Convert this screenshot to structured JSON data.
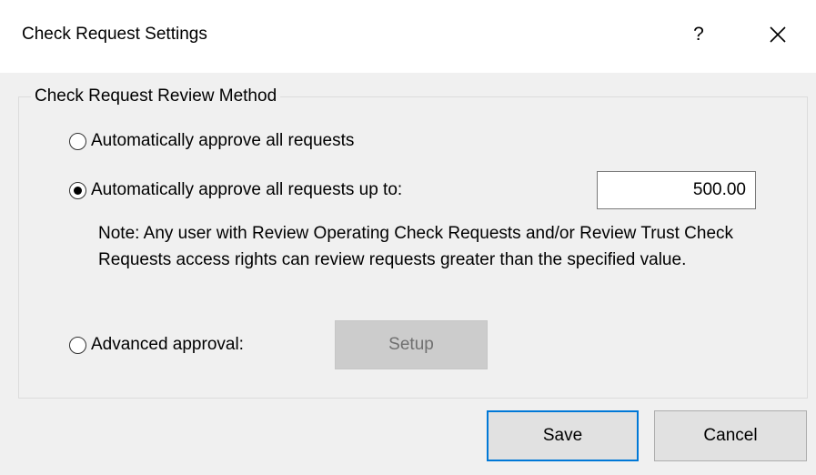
{
  "window": {
    "title": "Check Request Settings",
    "help_label": "?"
  },
  "review_method": {
    "legend": "Check Request Review Method",
    "options": [
      {
        "label": "Automatically approve all requests",
        "selected": false
      },
      {
        "label": "Automatically approve all requests up to:",
        "selected": true
      },
      {
        "label": "Advanced approval:",
        "selected": false
      }
    ],
    "amount_value": "500.00",
    "note": "Note: Any user with Review Operating Check Requests and/or Review Trust Check Requests access rights can review requests greater than the specified value.",
    "setup_label": "Setup"
  },
  "buttons": {
    "save_label": "Save",
    "cancel_label": "Cancel"
  },
  "colors": {
    "accent": "#0078d7",
    "background": "#f0f0f0",
    "disabled_button": "#cccccc"
  },
  "icons": [
    "help-icon",
    "close-icon",
    "radio-icon"
  ]
}
